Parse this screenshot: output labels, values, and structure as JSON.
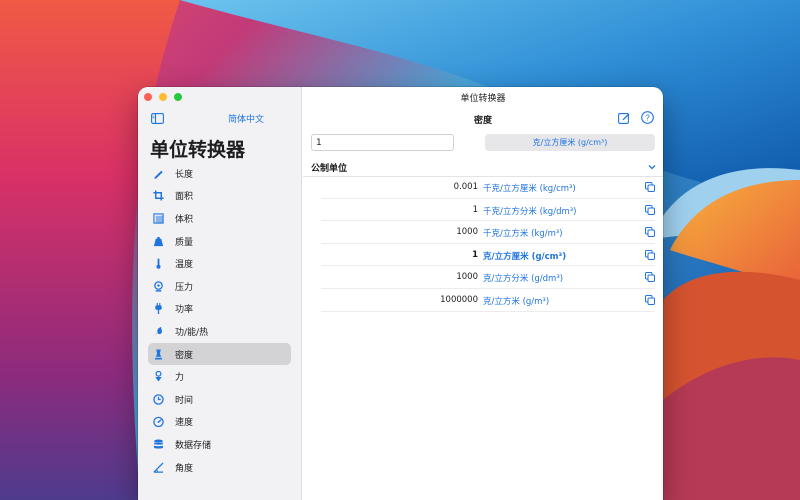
{
  "window": {
    "title": "单位转换器"
  },
  "sidebar": {
    "language_button": "简体中文",
    "title": "单位转换器",
    "items": [
      {
        "label": "长度",
        "icon": "ruler-pencil-icon",
        "active": false
      },
      {
        "label": "面积",
        "icon": "crop-icon",
        "active": false
      },
      {
        "label": "体积",
        "icon": "cube-icon",
        "active": false
      },
      {
        "label": "质量",
        "icon": "weight-icon",
        "active": false
      },
      {
        "label": "温度",
        "icon": "thermometer-icon",
        "active": false
      },
      {
        "label": "压力",
        "icon": "gauge-icon",
        "active": false
      },
      {
        "label": "功率",
        "icon": "plug-icon",
        "active": false
      },
      {
        "label": "功/能/热",
        "icon": "flame-icon",
        "active": false
      },
      {
        "label": "密度",
        "icon": "flask-icon",
        "active": true
      },
      {
        "label": "力",
        "icon": "arrow-icon",
        "active": false
      },
      {
        "label": "时间",
        "icon": "clock-icon",
        "active": false
      },
      {
        "label": "速度",
        "icon": "speedometer-icon",
        "active": false
      },
      {
        "label": "数据存储",
        "icon": "database-icon",
        "active": false
      },
      {
        "label": "角度",
        "icon": "angle-icon",
        "active": false
      }
    ]
  },
  "main": {
    "title": "密度",
    "input_value": "1",
    "selected_unit": "克/立方厘米 (g/cm³)",
    "section_label": "公制单位",
    "results": [
      {
        "value": "0.001",
        "unit": "千克/立方厘米 (kg/cm³)",
        "highlight": false
      },
      {
        "value": "1",
        "unit": "千克/立方分米 (kg/dm³)",
        "highlight": false
      },
      {
        "value": "1000",
        "unit": "千克/立方米 (kg/m³)",
        "highlight": false
      },
      {
        "value": "1",
        "unit": "克/立方厘米 (g/cm³)",
        "highlight": true
      },
      {
        "value": "1000",
        "unit": "克/立方分米 (g/dm³)",
        "highlight": false
      },
      {
        "value": "1000000",
        "unit": "克/立方米 (g/m³)",
        "highlight": false
      }
    ]
  },
  "colors": {
    "accent": "#1f74e0",
    "sidebar_bg": "#f2f2f4",
    "active_item_bg": "#d3d3d6"
  }
}
